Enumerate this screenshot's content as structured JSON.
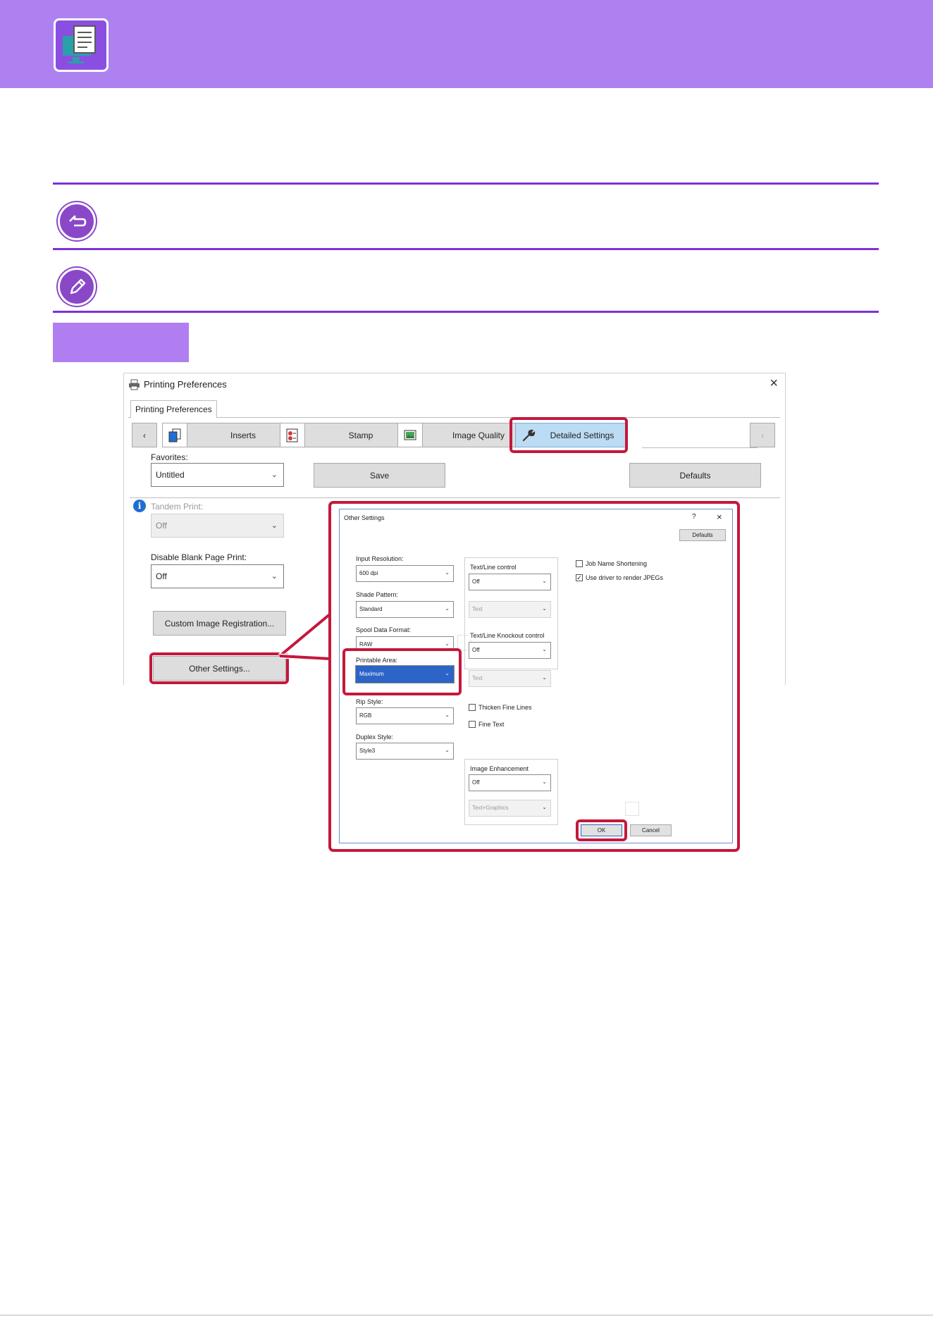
{
  "window": {
    "title": "Printing Preferences",
    "tab": "Printing Preferences",
    "tabs": [
      {
        "label": "Inserts",
        "icon": "copies-icon"
      },
      {
        "label": "Stamp",
        "icon": "stamp-icon"
      },
      {
        "label": "Image Quality",
        "icon": "image-icon"
      },
      {
        "label": "Detailed Settings",
        "icon": "wrench-icon"
      }
    ],
    "favorites_label": "Favorites:",
    "favorites_value": "Untitled",
    "save_label": "Save",
    "defaults_label": "Defaults",
    "tandem_label": "Tandem Print:",
    "tandem_value": "Off",
    "blank_label": "Disable Blank Page Print:",
    "blank_value": "Off",
    "custom_image_label": "Custom Image Registration...",
    "other_settings_label": "Other Settings..."
  },
  "dialog": {
    "title": "Other Settings",
    "help_glyph": "?",
    "close_glyph": "×",
    "defaults_label": "Defaults",
    "input_resolution_label": "Input Resolution:",
    "input_resolution_value": "600 dpi",
    "shade_pattern_label": "Shade Pattern:",
    "shade_pattern_value": "Standard",
    "spool_label": "Spool Data Format:",
    "spool_value": "RAW",
    "printable_area_label": "Printable Area:",
    "printable_area_value": "Maximum",
    "rip_label": "Rip Style:",
    "rip_value": "RGB",
    "duplex_label": "Duplex Style:",
    "duplex_value": "Style3",
    "textline_label": "Text/Line control",
    "textline_value": "Off",
    "textline_sub": "Text",
    "knockout_label": "Text/Line Knockout control",
    "knockout_value": "Off",
    "knockout_sub": "Text",
    "thicken_label": "Thicken Fine Lines",
    "fine_text_label": "Fine Text",
    "enhancement_label": "Image Enhancement",
    "enhancement_value": "Off",
    "enhancement_sub": "Text+Graphics",
    "job_name_label": "Job Name Shortening",
    "use_driver_label": "Use driver to render JPEGs",
    "ok_label": "OK",
    "cancel_label": "Cancel"
  },
  "colors": {
    "accent": "#ad82f0",
    "rule": "#7d32d4",
    "highlight": "#c4183c"
  }
}
